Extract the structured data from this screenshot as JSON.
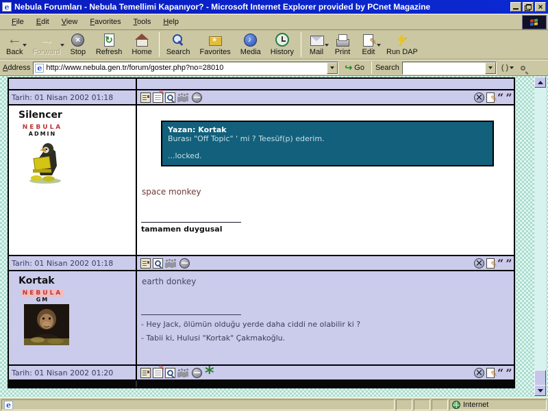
{
  "window": {
    "title": "Nebula Forumları - Nebula Temellimi Kapanıyor? - Microsoft Internet Explorer provided by PCnet Magazine",
    "controls": [
      "minimize",
      "restore",
      "close"
    ]
  },
  "menubar": {
    "items": [
      {
        "label": "File"
      },
      {
        "label": "Edit"
      },
      {
        "label": "View"
      },
      {
        "label": "Favorites"
      },
      {
        "label": "Tools"
      },
      {
        "label": "Help"
      }
    ]
  },
  "toolbar": {
    "buttons": [
      {
        "label": "Back",
        "icon": "back-icon",
        "dropdown": true,
        "disabled": false
      },
      {
        "label": "Forward",
        "icon": "forward-icon",
        "dropdown": true,
        "disabled": true
      },
      {
        "label": "Stop",
        "icon": "stop-icon"
      },
      {
        "label": "Refresh",
        "icon": "refresh-icon"
      },
      {
        "label": "Home",
        "icon": "home-icon"
      },
      {
        "label": "Search",
        "icon": "search-icon"
      },
      {
        "label": "Favorites",
        "icon": "favorites-icon"
      },
      {
        "label": "Media",
        "icon": "media-icon"
      },
      {
        "label": "History",
        "icon": "history-icon"
      },
      {
        "label": "Mail",
        "icon": "mail-icon",
        "dropdown": true
      },
      {
        "label": "Print",
        "icon": "print-icon"
      },
      {
        "label": "Edit",
        "icon": "edit-icon",
        "dropdown": true
      },
      {
        "label": "Run DAP",
        "icon": "lightning-icon"
      }
    ]
  },
  "addressbar": {
    "label": "Address",
    "url": "http://www.nebula.gen.tr/forum/goster.php?no=28010",
    "go_label": "Go",
    "search_label": "Search",
    "search_value": ""
  },
  "forum": {
    "footers": [
      {
        "date": "Tarih: 01 Nisan 2002 01:18",
        "icons_left": [
          "profile-card-icon",
          "edit-post-icon",
          "preview-icon",
          "buddies-icon",
          "offline-icon"
        ],
        "icons_right": [
          "delete-icon",
          "reply-icon",
          "quote-icon"
        ]
      },
      {
        "date": "Tarih: 01 Nisan 2002 01:18",
        "icons_left": [
          "profile-card-icon",
          "preview-icon",
          "buddies-icon",
          "offline-icon"
        ],
        "icons_right": [
          "delete-icon",
          "reply-icon",
          "quote-icon"
        ]
      },
      {
        "date": "Tarih: 01 Nisan 2002 01:20",
        "icons_left": [
          "profile-card-icon",
          "edit-post-icon",
          "preview-icon",
          "buddies-icon",
          "offline-icon",
          "ip-flower-icon"
        ],
        "icons_right": [
          "delete-icon",
          "reply-icon",
          "quote-icon"
        ]
      }
    ],
    "posts": [
      {
        "author": {
          "name": "Silencer",
          "badge": "NEBULA",
          "role": "ADMIN",
          "avatar": "penguin-laptop-avatar"
        },
        "quote": {
          "title": "Yazan: Kortak",
          "line1": "Burası \"Off Topic\" ' mi ? Teesüf(p) ederim.",
          "line2": "...locked."
        },
        "body": "space monkey",
        "signature": "tamamen duygusal"
      },
      {
        "author": {
          "name": "Kortak",
          "badge": "NEBULA",
          "role": "GM",
          "avatar": "chimp-avatar"
        },
        "body": "earth donkey",
        "sig_line1": "- Hey Jack, ölümün olduğu yerde daha ciddi ne olabilir ki ?",
        "sig_line2": "- Tabii ki, Hulusi \"Kortak\" Çakmakoğlu."
      }
    ]
  },
  "statusbar": {
    "zone_label": "Internet"
  },
  "colors": {
    "titlebar_blue": "#0a1cc0",
    "chrome_khaki": "#cbc7a3",
    "row_lavender": "#cbcbec",
    "quote_teal": "#12607c",
    "badge_red": "#c03434",
    "page_checker_green": "#a8dcd0",
    "date_text_navy": "#3c3c64"
  }
}
